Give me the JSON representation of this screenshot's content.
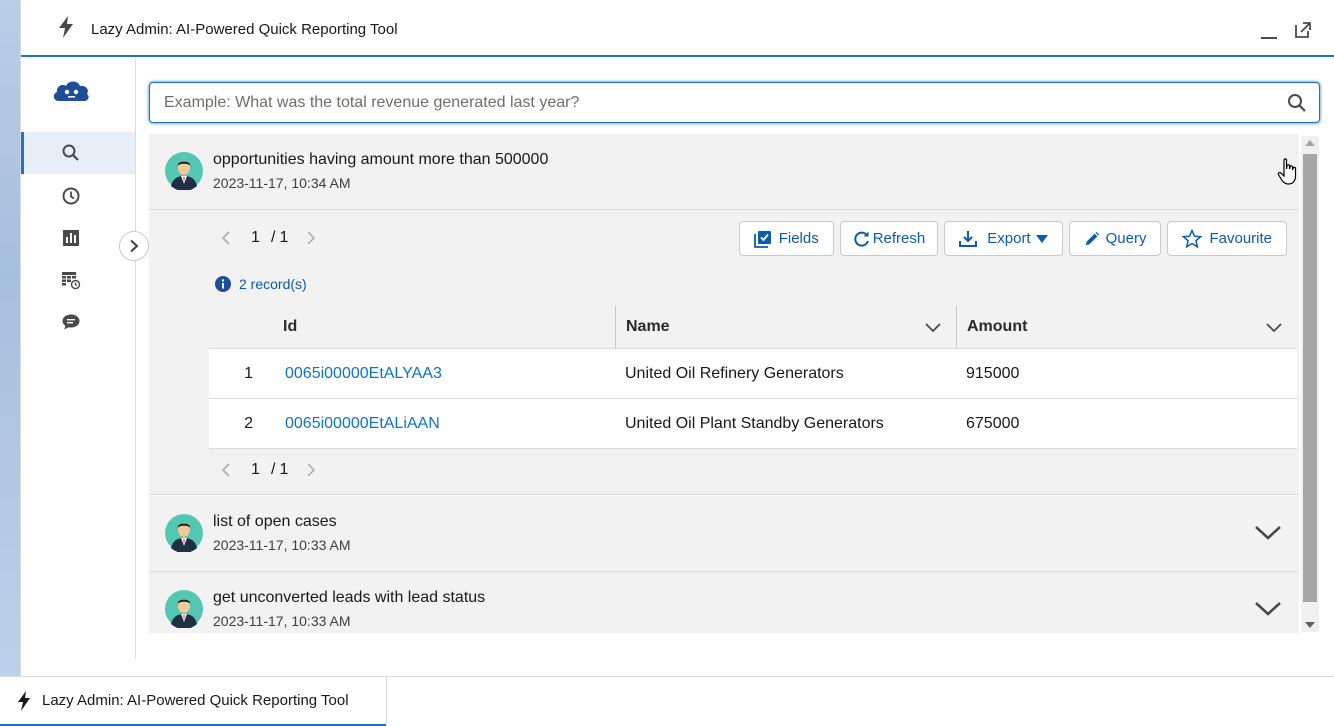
{
  "header": {
    "title": "Lazy Admin: AI-Powered Quick Reporting Tool",
    "bolt_icon": "bolt-icon",
    "minimize_icon": "minimize-icon",
    "popout_icon": "popout-icon"
  },
  "sidebar": {
    "logo": "cloud-bot-logo",
    "items": [
      {
        "name": "search",
        "icon": "search-icon",
        "active": true
      },
      {
        "name": "history",
        "icon": "clock-icon",
        "active": false
      },
      {
        "name": "reports",
        "icon": "bar-chart-icon",
        "active": false
      },
      {
        "name": "scheduled",
        "icon": "table-clock-icon",
        "active": false
      },
      {
        "name": "chat",
        "icon": "chat-icon",
        "active": false
      }
    ]
  },
  "search": {
    "placeholder": "Example: What was the total revenue generated last year?",
    "value": ""
  },
  "queries": [
    {
      "text": "opportunities having amount more than 500000",
      "time": "2023-11-17, 10:34 AM",
      "expanded": true,
      "pager": {
        "current": "1",
        "separator": "/",
        "total": "1"
      },
      "actions": {
        "fields": "Fields",
        "refresh": "Refresh",
        "export": "Export",
        "query": "Query",
        "favourite": "Favourite"
      },
      "record_count": "2 record(s)",
      "table": {
        "columns": [
          "Id",
          "Name",
          "Amount"
        ],
        "rows": [
          {
            "num": "1",
            "id": "0065i00000EtALYAA3",
            "name": "United Oil Refinery Generators",
            "amount": "915000"
          },
          {
            "num": "2",
            "id": "0065i00000EtALiAAN",
            "name": "United Oil Plant Standby Generators",
            "amount": "675000"
          }
        ]
      }
    },
    {
      "text": "list of open cases",
      "time": "2023-11-17, 10:33 AM",
      "expanded": false
    },
    {
      "text": "get unconverted leads with lead status",
      "time": "2023-11-17, 10:33 AM",
      "expanded": false
    }
  ],
  "taskbar": {
    "tab_label": "Lazy Admin: AI-Powered Quick Reporting Tool"
  },
  "colors": {
    "accent": "#1b74c9",
    "link": "#0b73c9",
    "panel": "#f3f2f2"
  }
}
